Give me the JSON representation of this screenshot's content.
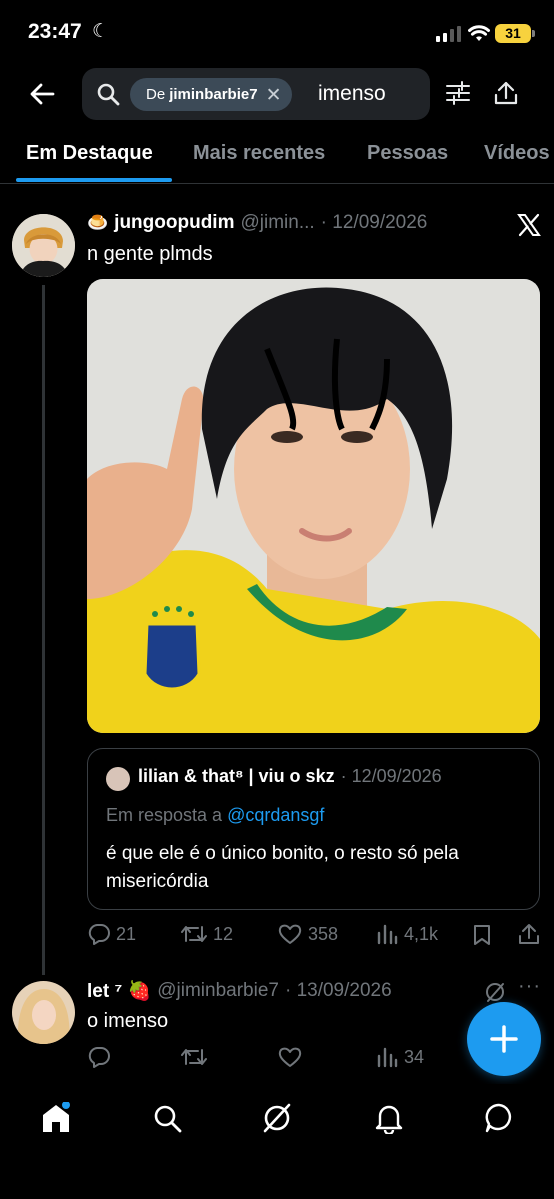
{
  "status_bar": {
    "time": "23:47",
    "battery": "31"
  },
  "search": {
    "chip_prefix": "De",
    "chip_user": "jiminbarbie7",
    "query": "imenso"
  },
  "tabs": [
    {
      "label": "Em Destaque",
      "active": true
    },
    {
      "label": "Mais recentes"
    },
    {
      "label": "Pessoas"
    },
    {
      "label": "Vídeos"
    }
  ],
  "tweet1": {
    "emoji": "🍮",
    "name": "jungoopudim",
    "handle": "@jimin...",
    "date": "· 12/09/2026",
    "text": "n gente plmds",
    "quote": {
      "name": "lilian & that⁸ | viu o skz",
      "date": "· 12/09/2026",
      "reply_prefix": "Em resposta a",
      "reply_handle": "@cqrdansgf",
      "text": "é que ele é o único bonito, o resto só pela misericórdia"
    },
    "actions": {
      "replies": "21",
      "retweets": "12",
      "likes": "358",
      "views": "4,1k"
    }
  },
  "tweet2": {
    "name": "let ⁷ 🍓 ",
    "handle": "@jiminbarbie7",
    "date": "· 13/09/2026",
    "text": "o imenso",
    "actions": {
      "views": "34"
    }
  },
  "colors": {
    "accent": "#1d9bf0",
    "background": "#000000",
    "muted": "#71767b",
    "chip": "#3c4a57"
  }
}
